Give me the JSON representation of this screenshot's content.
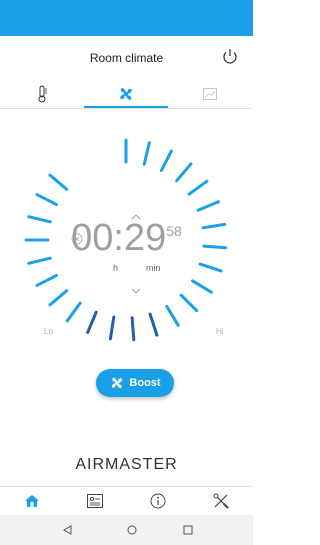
{
  "app": {
    "title": "Room climate"
  },
  "top_tabs": [
    {
      "icon": "thermometer-icon",
      "active": false
    },
    {
      "icon": "fan-icon",
      "active": true
    },
    {
      "icon": "chart-icon",
      "active": false
    }
  ],
  "timer": {
    "time": "00:29",
    "seconds": "58",
    "hours_label": "h",
    "minutes_label": "min"
  },
  "dial": {
    "low_label": "Lo",
    "high_label": "Hi"
  },
  "boost": {
    "label": "Boost"
  },
  "brand": "AIRMASTER",
  "bottom_nav": [
    {
      "icon": "home-icon",
      "active": true
    },
    {
      "icon": "list-card-icon",
      "active": false
    },
    {
      "icon": "info-icon",
      "active": false
    },
    {
      "icon": "tools-icon",
      "active": false
    }
  ],
  "android_nav": [
    {
      "icon": "back-icon"
    },
    {
      "icon": "home-circle-icon"
    },
    {
      "icon": "recents-icon"
    }
  ],
  "colors": {
    "accent": "#1aa0e6",
    "active_tick": "#1f5fae",
    "inactive_tick": "#1aa0e6"
  }
}
